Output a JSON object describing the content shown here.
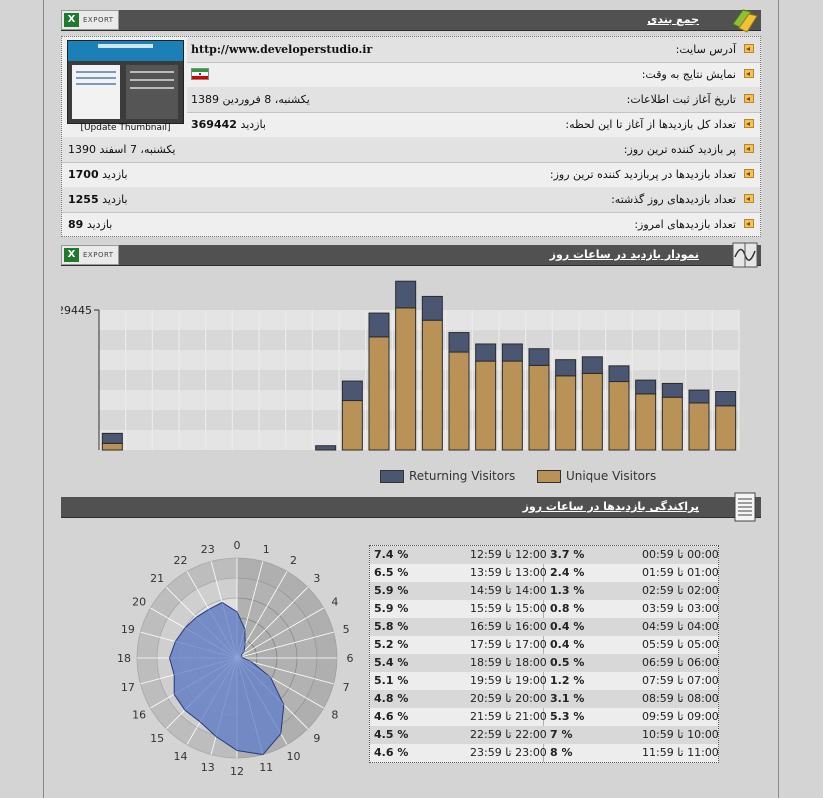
{
  "summary": {
    "title": "جمع بندی",
    "export_label": "EXPORT",
    "thumbnail_caption": "[Update Thumbnail]",
    "rows": [
      {
        "label": "آدرس سایت:",
        "value": "http://www.developerstudio.ir"
      },
      {
        "label": "نمایش نتایج به وقت:",
        "value": ""
      },
      {
        "label": "تاریخ آغاز ثبت اطلاعات:",
        "value": "یکشنبه، 8 فروردین 1389"
      },
      {
        "label": "تعداد کل بازدیدها از آغاز تا این لحظه:",
        "number": "369442",
        "unit": "بازدید"
      },
      {
        "label": "پر بازدید کننده ترین روز:",
        "value": "یکشنبه، 7 اسفند 1390"
      },
      {
        "label": "تعداد بازدیدها در پربازدید کننده ترین روز:",
        "number": "1700",
        "unit": "بازدید"
      },
      {
        "label": "تعداد بازدیدهای روز گذشته:",
        "number": "1255",
        "unit": "بازدید"
      },
      {
        "label": "تعداد بازدیدهای امروز:",
        "number": "89",
        "unit": "بازدید"
      }
    ]
  },
  "hourly_chart": {
    "title": "نمودار بازدید در ساعات روز",
    "export_label": "EXPORT"
  },
  "distribution": {
    "title": "پراکندگی بازدیدها در ساعات روز",
    "rows": [
      {
        "range_left": "12:00 تا 12:59",
        "pct_left": "7.4 %",
        "range_right": "00:00 تا 00:59",
        "pct_right": "3.7 %"
      },
      {
        "range_left": "13:00 تا 13:59",
        "pct_left": "6.5 %",
        "range_right": "01:00 تا 01:59",
        "pct_right": "2.4 %"
      },
      {
        "range_left": "14:00 تا 14:59",
        "pct_left": "5.9 %",
        "range_right": "02:00 تا 02:59",
        "pct_right": "1.3 %"
      },
      {
        "range_left": "15:00 تا 15:59",
        "pct_left": "5.9 %",
        "range_right": "03:00 تا 03:59",
        "pct_right": "0.8 %"
      },
      {
        "range_left": "16:00 تا 16:59",
        "pct_left": "5.8 %",
        "range_right": "04:00 تا 04:59",
        "pct_right": "0.4 %"
      },
      {
        "range_left": "17:00 تا 17:59",
        "pct_left": "5.2 %",
        "range_right": "05:00 تا 05:59",
        "pct_right": "0.4 %"
      },
      {
        "range_left": "18:00 تا 18:59",
        "pct_left": "5.4 %",
        "range_right": "06:00 تا 06:59",
        "pct_right": "0.5 %"
      },
      {
        "range_left": "19:00 تا 19:59",
        "pct_left": "5.1 %",
        "range_right": "07:00 تا 07:59",
        "pct_right": "1.2 %"
      },
      {
        "range_left": "20:00 تا 20:59",
        "pct_left": "4.8 %",
        "range_right": "08:00 تا 08:59",
        "pct_right": "3.1 %"
      },
      {
        "range_left": "21:00 تا 21:59",
        "pct_left": "4.6 %",
        "range_right": "09:00 تا 09:59",
        "pct_right": "5.3 %"
      },
      {
        "range_left": "22:00 تا 22:59",
        "pct_left": "4.5 %",
        "range_right": "10:00 تا 10:59",
        "pct_right": "7 %"
      },
      {
        "range_left": "23:00 تا 23:59",
        "pct_left": "4.6 %",
        "range_right": "11:00 تا 11:59",
        "pct_right": "8 %"
      }
    ]
  },
  "colors": {
    "header_bar": "#515151",
    "returning": "#4a5672",
    "unique": "#b89256",
    "radar_fill": "#6f87c4"
  },
  "chart_data": [
    {
      "type": "bar",
      "stacked": true,
      "title": "",
      "y_max_label": "29445",
      "ylim": [
        0,
        29445
      ],
      "grid": true,
      "legend_position": "bottom",
      "categories": [
        "0",
        "1",
        "2",
        "3",
        "4",
        "5",
        "6",
        "7",
        "8",
        "9",
        "10",
        "11",
        "12",
        "13",
        "14",
        "15",
        "16",
        "17",
        "18",
        "19",
        "20",
        "21",
        "22",
        "23"
      ],
      "series": [
        {
          "name": "Unique Visitors",
          "values": [
            1400,
            0,
            0,
            0,
            0,
            0,
            0,
            0,
            0,
            10400,
            23800,
            29900,
            27300,
            20600,
            18700,
            18700,
            17800,
            15600,
            16100,
            14400,
            11800,
            11100,
            9900,
            9300
          ]
        },
        {
          "name": "Returning Visitors",
          "values": [
            2100,
            0,
            0,
            0,
            0,
            0,
            0,
            0,
            900,
            4100,
            5000,
            5600,
            5000,
            4100,
            3600,
            3600,
            3500,
            3400,
            3500,
            3300,
            2900,
            2900,
            2700,
            3000
          ]
        }
      ]
    },
    {
      "type": "radar",
      "categories": [
        "0",
        "1",
        "2",
        "3",
        "4",
        "5",
        "6",
        "7",
        "8",
        "9",
        "10",
        "11",
        "12",
        "13",
        "14",
        "15",
        "16",
        "17",
        "18",
        "19",
        "20",
        "21",
        "22",
        "23"
      ],
      "values": [
        3.7,
        2.4,
        1.3,
        0.8,
        0.4,
        0.4,
        0.5,
        1.2,
        3.1,
        5.3,
        7,
        8,
        7.4,
        6.5,
        5.9,
        5.9,
        5.8,
        5.2,
        5.4,
        5.1,
        4.8,
        4.6,
        4.5,
        4.6
      ],
      "rlim": [
        0,
        8
      ]
    }
  ]
}
